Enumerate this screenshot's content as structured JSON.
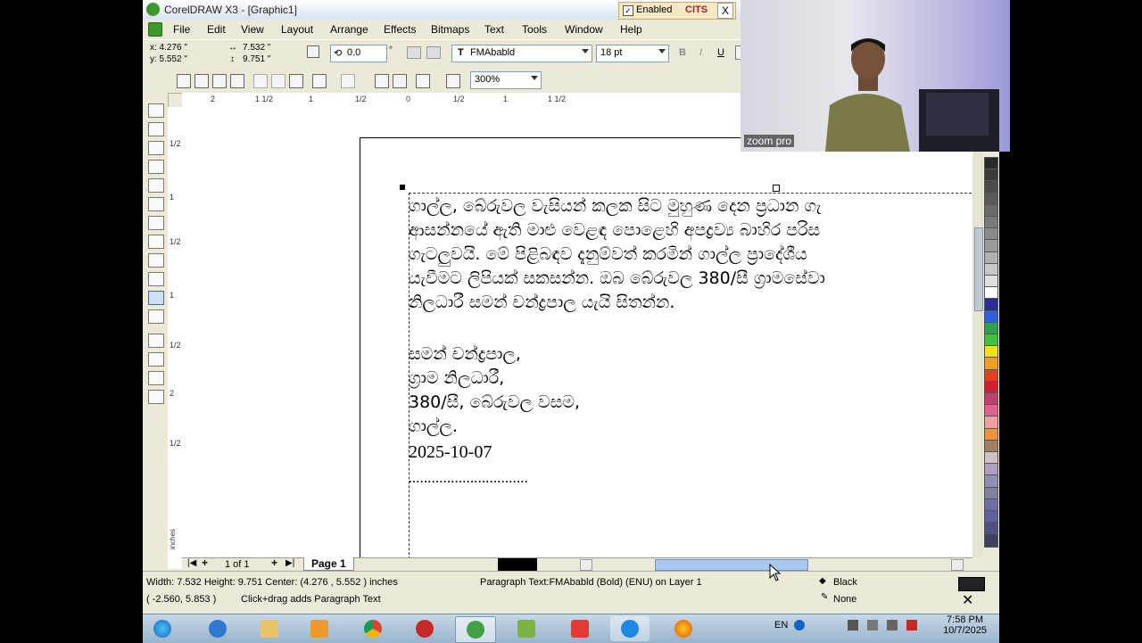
{
  "window": {
    "title": "CorelDRAW X3 - [Graphic1]",
    "enabled_label": "Enabled",
    "cits_label": "CITS",
    "close_label": "X"
  },
  "menu": [
    "File",
    "Edit",
    "View",
    "Layout",
    "Arrange",
    "Effects",
    "Bitmaps",
    "Text",
    "Tools",
    "Window",
    "Help"
  ],
  "property_bar": {
    "x": "x: 4.276 \"",
    "y": "y: 5.552 \"",
    "w": "7.532 \"",
    "h": "9.751 \"",
    "angle": "0.0",
    "degree_symbol": "°",
    "font": "FMAbabld",
    "size": "18 pt",
    "bold": "B",
    "italic": "I",
    "underline": "U"
  },
  "standard_bar": {
    "zoom": "300%"
  },
  "ruler": {
    "h_labels": [
      "2",
      "1 1/2",
      "1",
      "1/2",
      "0",
      "1/2",
      "1",
      "1 1/2"
    ],
    "v_labels": [
      "1/2",
      "1",
      "1/2",
      "1",
      "1/2",
      "2",
      "1/2"
    ],
    "unit": "inches"
  },
  "document": {
    "paragraph_lines": [
      "ගාල්ල, බේරුවල වැසියන් කලක සිට මුහුණ දෙන ප්‍රධාන ගැ",
      "ආසන්නයේ ඇති මාළු වෙළඳ පොළෙහි අපද්‍රව්‍ය බාහිර පරිස",
      "ගැටලුවයි. මේ පිළිබඳව දැනුම්වත් කරමින් ගාල්ල ප්‍රාදේශීය ",
      "යැවීමට ලිපියක් සකසන්න. ඔබ බේරුවල 380/සී ග්‍රාමසේවා ",
      "නිලධාරී සමන් චන්ද්‍රපාල යැයි සිතන්න."
    ],
    "signature_lines": [
      "සමන් චන්ද්‍රපාල,",
      "ග්‍රාම නිලධාරී,",
      "380/සී, බේරුවල වසම,",
      "ගාල්ල."
    ],
    "date": "2025-10-07",
    "dots": "..............................."
  },
  "navigator": {
    "page_count": "1 of 1",
    "page_tab": "Page 1"
  },
  "status": {
    "dimensions": "Width: 7.532  Height: 9.751  Center: (4.276 , 5.552 )  inches",
    "cursor": "( -2.560, 5.853 )",
    "hint": "Click+drag adds Paragraph Text",
    "object_info": "Paragraph Text:FMAbabld (Bold) (ENU) on Layer 1",
    "fill": "Black",
    "outline": "None"
  },
  "webcam": {
    "label": "zoom pro"
  },
  "taskbar": {
    "lang": "EN",
    "time": "7:58 PM",
    "date": "10/7/2025"
  },
  "colors": {
    "palette": [
      "#2a2a2a",
      "#3a3a3a",
      "#4a4a4a",
      "#5a5a5a",
      "#6a6a6a",
      "#7a7a7a",
      "#8a8a8a",
      "#9a9a9a",
      "#b0b0b0",
      "#c8c8c8",
      "#e0e0e0",
      "#ffffff",
      "#2a2a9a",
      "#3060e0",
      "#30a050",
      "#40c040",
      "#f0e020",
      "#f0a020",
      "#e04020",
      "#d02030",
      "#c04070",
      "#e06090",
      "#f0a0a0",
      "#f09040",
      "#a08060",
      "#d0c0c0",
      "#b0a0c0",
      "#9090b0",
      "#8080a0",
      "#7070a0",
      "#6060a0",
      "#505080",
      "#404060"
    ]
  }
}
